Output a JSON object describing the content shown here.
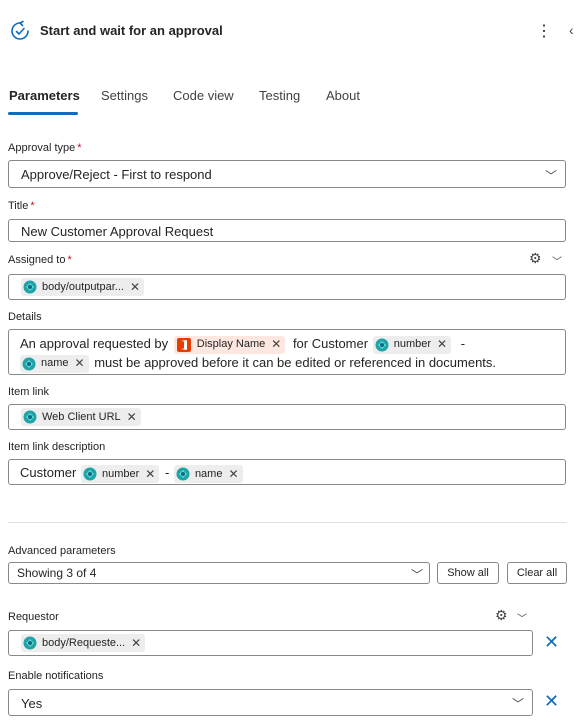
{
  "header": {
    "title": "Start and wait for an approval",
    "icon": "approval-cycle-icon",
    "accent": "#0f6cbd"
  },
  "tabs": [
    {
      "label": "Parameters",
      "active": true
    },
    {
      "label": "Settings"
    },
    {
      "label": "Code view"
    },
    {
      "label": "Testing"
    },
    {
      "label": "About"
    }
  ],
  "fields": {
    "approval_type": {
      "label": "Approval type",
      "required": "*",
      "value": "Approve/Reject - First to respond"
    },
    "title": {
      "label": "Title",
      "required": "*",
      "value": "New Customer Approval Request"
    },
    "assigned_to": {
      "label": "Assigned to",
      "required": "*",
      "token": "body/outputpar..."
    },
    "details": {
      "label": "Details",
      "text1": "An approval requested by",
      "token_display_name": "Display Name",
      "text2": "for Customer",
      "token_number": "number",
      "dash": "-",
      "token_name": "name",
      "text3": "must be approved before it can be edited or referenced in documents."
    },
    "item_link": {
      "label": "Item link",
      "token": "Web Client URL"
    },
    "item_link_description": {
      "label": "Item link description",
      "text1": "Customer",
      "token_number": "number",
      "dash": "-",
      "token_name": "name"
    }
  },
  "advanced": {
    "label": "Advanced parameters",
    "value": "Showing 3 of 4",
    "show_all": "Show all",
    "clear_all": "Clear all"
  },
  "requestor": {
    "label": "Requestor",
    "token": "body/Requeste..."
  },
  "notifications": {
    "label": "Enable notifications",
    "value": "Yes"
  }
}
